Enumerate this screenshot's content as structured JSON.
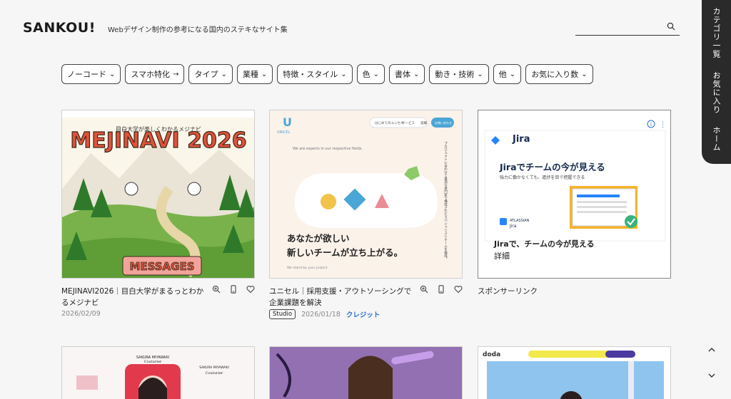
{
  "header": {
    "logo": "SANKOU!",
    "tagline": "Webデザイン制作の参考になる国内のステキなサイト集",
    "search_placeholder": ""
  },
  "side_tab": {
    "items": [
      "カテゴリ一覧",
      "お気に入り",
      "ホーム"
    ]
  },
  "filters": [
    {
      "label": "ノーコード",
      "arrow": "⌄"
    },
    {
      "label": "スマホ特化",
      "arrow": "→"
    },
    {
      "label": "タイプ",
      "arrow": "⌄"
    },
    {
      "label": "業種",
      "arrow": "⌄"
    },
    {
      "label": "特徴・スタイル",
      "arrow": "⌄"
    },
    {
      "label": "色",
      "arrow": "⌄"
    },
    {
      "label": "書体",
      "arrow": "⌄"
    },
    {
      "label": "動き・技術",
      "arrow": "⌄"
    },
    {
      "label": "他",
      "arrow": "⌄"
    },
    {
      "label": "お気に入り数",
      "arrow": "⌄"
    }
  ],
  "cards": [
    {
      "title": "MEJINAVI2026｜目白大学がまるっとわかるメジナビ",
      "date": "2026/02/09",
      "thumb": {
        "headline": "MEJINAVI 2026",
        "sub": "目白大学が楽しくわかるメジナビ",
        "footer": "MESSAGES"
      }
    },
    {
      "title": "ユニセル｜採用支援・アウトソーシングで企業課題を解決",
      "tag": "Studio",
      "date": "2026/01/18",
      "credit": "クレジット",
      "thumb": {
        "brand": "UNICEL",
        "headline1": "あなたが欲しい",
        "headline2": "新しいチームが立ち上がる。",
        "small": "We are experts in our respective fields.",
        "vertical": "プロジェクトに合わせて最適な専門家で構成されたスペシャリストチームを編成。",
        "nav1": "はじめてのユニセル",
        "nav2": "サービス",
        "nav3": "実績",
        "cta": "お問い合わせ",
        "foot": "We stand by your project."
      }
    },
    {
      "title": "スポンサーリンク",
      "thumb": {
        "brand": "Jira",
        "headline": "Jiraでチームの今が見える",
        "sub": "強力に働かなくても、進捗を目で把握できる",
        "atlassian": "ATLASSIAN",
        "atlassian_product": "Jira",
        "ad_title": "Jiraで、チームの今が見える",
        "ad_link": "詳細"
      }
    }
  ],
  "row2": {
    "card1_brand": "Couturier",
    "card1_name": "SAKURA MIYAWAKI",
    "card3_brand": "doda"
  },
  "colors": {
    "accent": "#2b6fc9",
    "dark": "#2a2a2a",
    "bg": "#f6f6f6"
  }
}
